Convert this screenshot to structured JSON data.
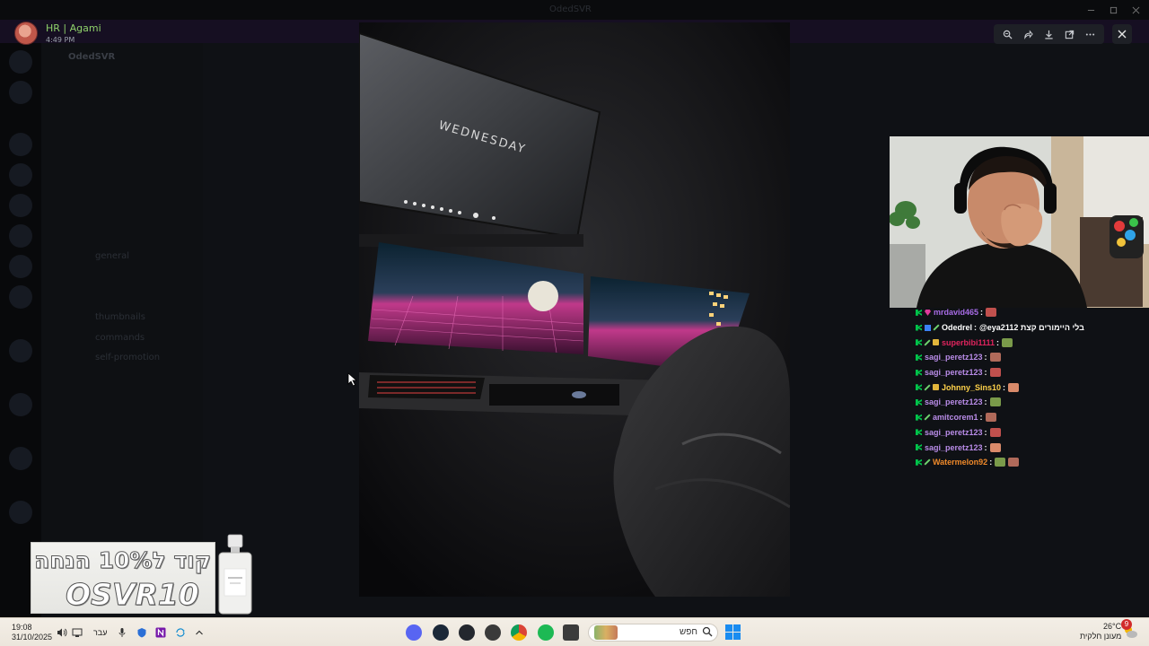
{
  "window": {
    "title": "OdedSVR"
  },
  "viewer": {
    "author_name": "HR | Agami",
    "timestamp": "4:49 PM",
    "toolbar_icons": [
      "zoom-icon",
      "forward-icon",
      "download-icon",
      "open-external-icon",
      "more-icon"
    ],
    "close_icon": "close-icon"
  },
  "background": {
    "server_name": "OdedSVR",
    "channels": [
      "general",
      "thumbnails",
      "commands",
      "self-promotion"
    ]
  },
  "chat": {
    "messages": [
      {
        "user": "mrdavid465",
        "color": "#a86ce6",
        "badges": [
          "mod",
          "vip"
        ],
        "message": "",
        "emotes": 1
      },
      {
        "user": "Odedrel",
        "color": "#ffffff",
        "badges": [
          "mod",
          "blue",
          "sword"
        ],
        "message": "@eya2112 בלי היימורים קצת",
        "emotes": 0
      },
      {
        "user": "superbibi1111",
        "color": "#e0245e",
        "badges": [
          "mod",
          "sword",
          "sub"
        ],
        "message": "",
        "emotes": 1
      },
      {
        "user": "sagi_peretz123",
        "color": "#b98ce8",
        "badges": [
          "mod"
        ],
        "message": "",
        "emotes": 1
      },
      {
        "user": "sagi_peretz123",
        "color": "#b98ce8",
        "badges": [
          "mod"
        ],
        "message": "",
        "emotes": 1
      },
      {
        "user": "Johnny_Sins10",
        "color": "#ffd24a",
        "badges": [
          "mod",
          "sword",
          "sub"
        ],
        "message": "",
        "emotes": 1
      },
      {
        "user": "sagi_peretz123",
        "color": "#b98ce8",
        "badges": [
          "mod"
        ],
        "message": "",
        "emotes": 1
      },
      {
        "user": "amitcorem1",
        "color": "#b98ce8",
        "badges": [
          "mod",
          "sword"
        ],
        "message": "",
        "emotes": 1
      },
      {
        "user": "sagi_peretz123",
        "color": "#b98ce8",
        "badges": [
          "mod"
        ],
        "message": "",
        "emotes": 1
      },
      {
        "user": "sagi_peretz123",
        "color": "#b98ce8",
        "badges": [
          "mod"
        ],
        "message": "",
        "emotes": 1
      },
      {
        "user": "Watermelon92",
        "color": "#f08a2a",
        "badges": [
          "mod",
          "sword"
        ],
        "message": "",
        "emotes": 2
      }
    ]
  },
  "ad": {
    "line1": "קוד ל10% הנחה",
    "line2": "OSVR10"
  },
  "taskbar": {
    "time": "19:08",
    "date": "31/10/2025",
    "language": "עבר",
    "search_label": "חפש",
    "weather_temp": "26°C",
    "weather_desc": "מעונן חלקית",
    "notification_count": "9"
  }
}
